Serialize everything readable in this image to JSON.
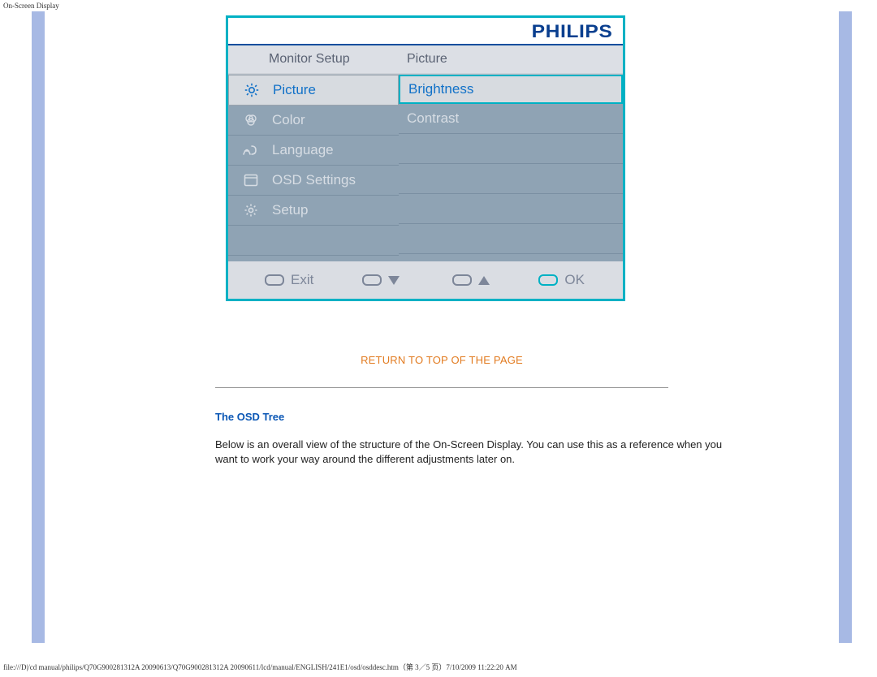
{
  "page_header": "On-Screen Display",
  "osd": {
    "brand": "PHILIPS",
    "title_left": "Monitor Setup",
    "title_right": "Picture",
    "menu": [
      {
        "label": "Picture",
        "selected": true,
        "icon": "brightness-icon"
      },
      {
        "label": "Color",
        "selected": false,
        "icon": "color-icon"
      },
      {
        "label": "Language",
        "selected": false,
        "icon": "language-icon"
      },
      {
        "label": "OSD Settings",
        "selected": false,
        "icon": "osd-settings-icon"
      },
      {
        "label": "Setup",
        "selected": false,
        "icon": "setup-icon"
      }
    ],
    "submenu": [
      {
        "label": "Brightness",
        "selected": true
      },
      {
        "label": "Contrast",
        "selected": false
      }
    ],
    "footer": {
      "exit": "Exit",
      "ok": "OK"
    }
  },
  "return_link": "RETURN TO TOP OF THE PAGE",
  "section_heading": "The OSD Tree",
  "body_text": "Below is an overall view of the structure of the On-Screen Display. You can use this as a reference when you want to work your way around the different adjustments later on.",
  "footer_path": "file:///D|/cd manual/philips/Q70G900281312A 20090613/Q70G900281312A 20090611/lcd/manual/ENGLISH/241E1/osd/osddesc.htm（第 3／5 页）7/10/2009 11:22:20 AM"
}
